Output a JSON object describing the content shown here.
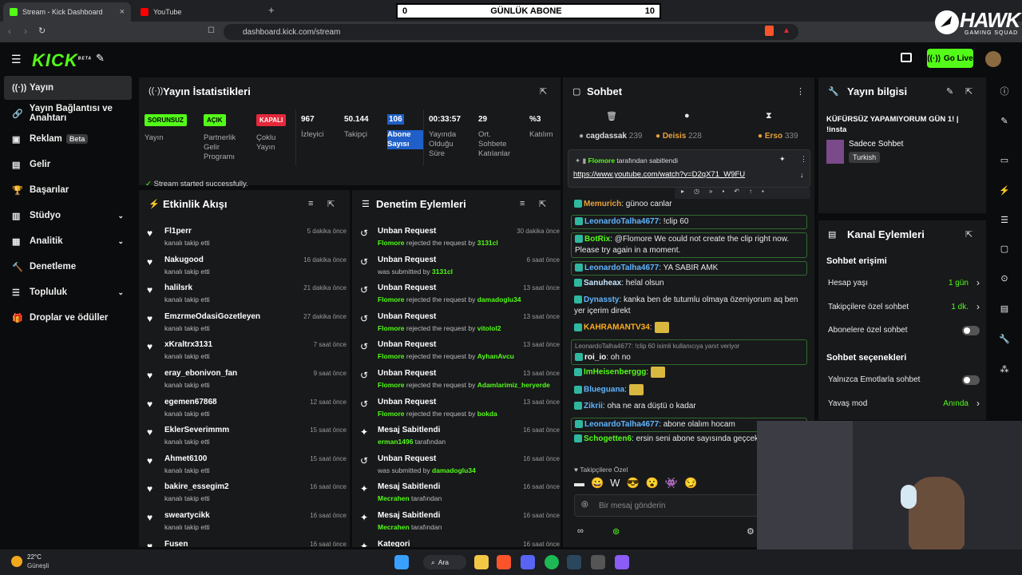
{
  "browser": {
    "tabs": [
      {
        "title": "Stream - Kick Dashboard",
        "close": "×"
      },
      {
        "title": "YouTube"
      }
    ],
    "new_tab": "+",
    "url": "dashboard.kick.com/stream"
  },
  "overlay": {
    "left": "0",
    "center": "GÜNLÜK ABONE",
    "right": "10"
  },
  "watermark": {
    "title": "HAWK",
    "subtitle": "GAMING SQUAD"
  },
  "topnav": {
    "logo": "KICK",
    "logo_sup": "BETA",
    "go_live": "Go Live"
  },
  "sidebar": [
    {
      "label": "Yayın",
      "icon": "broadcast-icon",
      "glyph": "((·))"
    },
    {
      "label": "Yayın Bağlantısı ve Anahtarı",
      "icon": "link-icon",
      "glyph": "🔗"
    },
    {
      "label": "Reklam",
      "icon": "ad-icon",
      "glyph": "▣",
      "badge": "Beta"
    },
    {
      "label": "Gelir",
      "icon": "wallet-icon",
      "glyph": "▤"
    },
    {
      "label": "Başarılar",
      "icon": "trophy-icon",
      "glyph": "🏆"
    },
    {
      "label": "Stüdyo",
      "icon": "studio-icon",
      "glyph": "▥",
      "chev": "⌄"
    },
    {
      "label": "Analitik",
      "icon": "chart-icon",
      "glyph": "▦",
      "chev": "⌄"
    },
    {
      "label": "Denetleme",
      "icon": "moderation-icon",
      "glyph": "🔨"
    },
    {
      "label": "Topluluk",
      "icon": "community-icon",
      "glyph": "☰",
      "chev": "⌄"
    },
    {
      "label": "Droplar ve ödüller",
      "icon": "gift-icon",
      "glyph": "🎁"
    }
  ],
  "stats": {
    "title": "Yayın İstatistikleri",
    "cols": [
      {
        "tag": "SORUNSUZ",
        "label": "Yayın"
      },
      {
        "tag": "AÇIK",
        "label": "Partnerlik Gelir Programı"
      },
      {
        "tag": "KAPALI",
        "label": "Çoklu Yayın"
      },
      {
        "value": "967",
        "label": "İzleyici"
      },
      {
        "value": "50.144",
        "label": "Takipçi"
      },
      {
        "value": "106",
        "label": "Abone Sayısı"
      },
      {
        "value": "00:33:57",
        "label": "Yayında Olduğu Süre"
      },
      {
        "value": "29",
        "label": "Ort. Sohbete Katılanlar"
      },
      {
        "value": "%3",
        "label": "Katılım"
      }
    ],
    "notice": "Stream started successfully."
  },
  "activity": {
    "title": "Etkinlik Akışı",
    "items": [
      {
        "name": "Fl1perr",
        "sub": "kanalı takip etti",
        "time": "5 dakika önce"
      },
      {
        "name": "Nakugood",
        "sub": "kanalı takip etti",
        "time": "16 dakika önce"
      },
      {
        "name": "halilsrk",
        "sub": "kanalı takip etti",
        "time": "21 dakika önce"
      },
      {
        "name": "EmzrmeOdasiGozetleyen",
        "sub": "kanalı takip etti",
        "time": "27 dakika önce"
      },
      {
        "name": "xKraltrx3131",
        "sub": "kanalı takip etti",
        "time": "7 saat önce"
      },
      {
        "name": "eray_ebonivon_fan",
        "sub": "kanalı takip etti",
        "time": "9 saat önce"
      },
      {
        "name": "egemen67868",
        "sub": "kanalı takip etti",
        "time": "12 saat önce"
      },
      {
        "name": "EklerSeverimmm",
        "sub": "kanalı takip etti",
        "time": "15 saat önce"
      },
      {
        "name": "Ahmet6100",
        "sub": "kanalı takip etti",
        "time": "15 saat önce"
      },
      {
        "name": "bakire_essegim2",
        "sub": "kanalı takip etti",
        "time": "16 saat önce"
      },
      {
        "name": "sweartycikk",
        "sub": "kanalı takip etti",
        "time": "16 saat önce"
      },
      {
        "name": "Fusen",
        "sub": "",
        "time": "16 saat önce"
      }
    ]
  },
  "moderation": {
    "title": "Denetim Eylemleri",
    "items": [
      {
        "name": "Unban Request",
        "who": "Flomore",
        "mid": " rejected the request by ",
        "target": "3131cl",
        "time": "30 dakika önce",
        "icon": "undo-icon"
      },
      {
        "name": "Unban Request",
        "who": "",
        "mid": "was submitted by ",
        "target": "3131cl",
        "time": "6 saat önce",
        "icon": "undo-icon"
      },
      {
        "name": "Unban Request",
        "who": "Flomore",
        "mid": " rejected the request by ",
        "target": "damadoglu34",
        "time": "13 saat önce",
        "icon": "undo-icon"
      },
      {
        "name": "Unban Request",
        "who": "Flomore",
        "mid": " rejected the request by ",
        "target": "vitolol2",
        "time": "13 saat önce",
        "icon": "undo-icon"
      },
      {
        "name": "Unban Request",
        "who": "Flomore",
        "mid": " rejected the request by ",
        "target": "AyhanAvcu",
        "time": "13 saat önce",
        "icon": "undo-icon"
      },
      {
        "name": "Unban Request",
        "who": "Flomore",
        "mid": " rejected the request by ",
        "target": "Adamlarimiz_heryerde",
        "time": "13 saat önce",
        "icon": "undo-icon"
      },
      {
        "name": "Unban Request",
        "who": "Flomore",
        "mid": " rejected the request by ",
        "target": "bokda",
        "time": "13 saat önce",
        "icon": "undo-icon"
      },
      {
        "name": "Mesaj Sabitlendi",
        "who": "erman1496",
        "mid": " tarafından",
        "target": "",
        "time": "16 saat önce",
        "icon": "pin-icon"
      },
      {
        "name": "Unban Request",
        "who": "",
        "mid": "was submitted by ",
        "target": "damadoglu34",
        "time": "16 saat önce",
        "icon": "undo-icon"
      },
      {
        "name": "Mesaj Sabitlendi",
        "who": "Mecrahen",
        "mid": " tarafından",
        "target": "",
        "time": "16 saat önce",
        "icon": "pin-icon"
      },
      {
        "name": "Mesaj Sabitlendi",
        "who": "Mecrahen",
        "mid": " tarafından",
        "target": "",
        "time": "16 saat önce",
        "icon": "pin-icon"
      },
      {
        "name": "Kategori",
        "who": "",
        "mid": "",
        "target": "",
        "time": "16 saat önce",
        "icon": "pin-icon"
      }
    ]
  },
  "chat": {
    "title": "Sohbet",
    "top_users": [
      {
        "name": "cagdassak",
        "count": "239"
      },
      {
        "name": "Deisis",
        "count": "228"
      },
      {
        "name": "Erso",
        "count": "339"
      }
    ],
    "pinned_by": "Flomore",
    "pinned_suffix": " tarafından sabitlendi",
    "pinned_link": "https://www.youtube.com/watch?v=D2qX71_W9FU",
    "messages": [
      {
        "user": "Memurich",
        "color": "#e8a23a",
        "text": ": günoo canlar"
      },
      {
        "user": "LeonardoTalha4677",
        "color": "#60b6ff",
        "text": ": !clip 60",
        "boxed": true
      },
      {
        "user": "BotRix",
        "color": "#53fc18",
        "text": ": @Flomore We could not create the clip right now. Please try again in a moment.",
        "boxed": true,
        "mention": "@Flomore"
      },
      {
        "user": "LeonardoTalha4677",
        "color": "#60b6ff",
        "text": ": YA SABIR AMK",
        "boxed": true
      },
      {
        "user": "Sanuheax",
        "color": "#c8e8ff",
        "text": ": helal olsun"
      },
      {
        "user": "Dynassty",
        "color": "#60b6ff",
        "text": ": kanka ben de tutumlu olmaya özeniyorum aq ben yer içerim direkt"
      },
      {
        "user": "KAHRAMANTV34",
        "color": "#ffb020",
        "text": ":"
      },
      {
        "reply": "LeonardoTalha4677: !clip 60 isimli kullanıcıya yanıt veriyor",
        "user": "roi_io",
        "color": "#ffffff",
        "text": ": oh no",
        "boxed": true
      },
      {
        "user": "ImHeisenberggg",
        "color": "#53fc18",
        "text": ":"
      },
      {
        "user": "Blueguana",
        "color": "#60b6ff",
        "text": ":"
      },
      {
        "user": "Zikrii",
        "color": "#60b6ff",
        "text": ": oha ne ara düştü o kadar"
      },
      {
        "user": "LeonardoTalha4677",
        "color": "#60b6ff",
        "text": ": abone olalım hocam",
        "boxed": true
      },
      {
        "user": "Schogetten6",
        "color": "#53fc18",
        "text": ": ersin seni abone sayısında geçcek ihtimalle"
      }
    ],
    "follower_label": "Takipçilere Özel",
    "input_placeholder": "Bir mesaj gönderin"
  },
  "stream_info": {
    "title": "Yayın bilgisi",
    "stream_title": "KÜFÜRSÜZ YAPAMIYORUM GÜN 1! | !insta",
    "category": "Sadece Sohbet",
    "tag": "Turkish"
  },
  "channel_actions": {
    "title": "Kanal Eylemleri",
    "access_header": "Sohbet erişimi",
    "rows": [
      {
        "label": "Hesap yaşı",
        "value": "1 gün"
      },
      {
        "label": "Takipçilere özel sohbet",
        "value": "1 dk."
      },
      {
        "label": "Abonelere özel sohbet",
        "value": ""
      }
    ],
    "options_header": "Sohbet seçenekleri",
    "rows2": [
      {
        "label": "Yalnızca Emotlarla sohbet",
        "value": ""
      },
      {
        "label": "Yavaş mod",
        "value": "Anında"
      }
    ]
  },
  "taskbar": {
    "temp": "22°C",
    "weather": "Güneşli",
    "search": "Ara"
  },
  "colors": {
    "accent": "#53fc18",
    "panel": "#18191b",
    "bg": "#0b0c0d",
    "red": "#e5283a"
  }
}
